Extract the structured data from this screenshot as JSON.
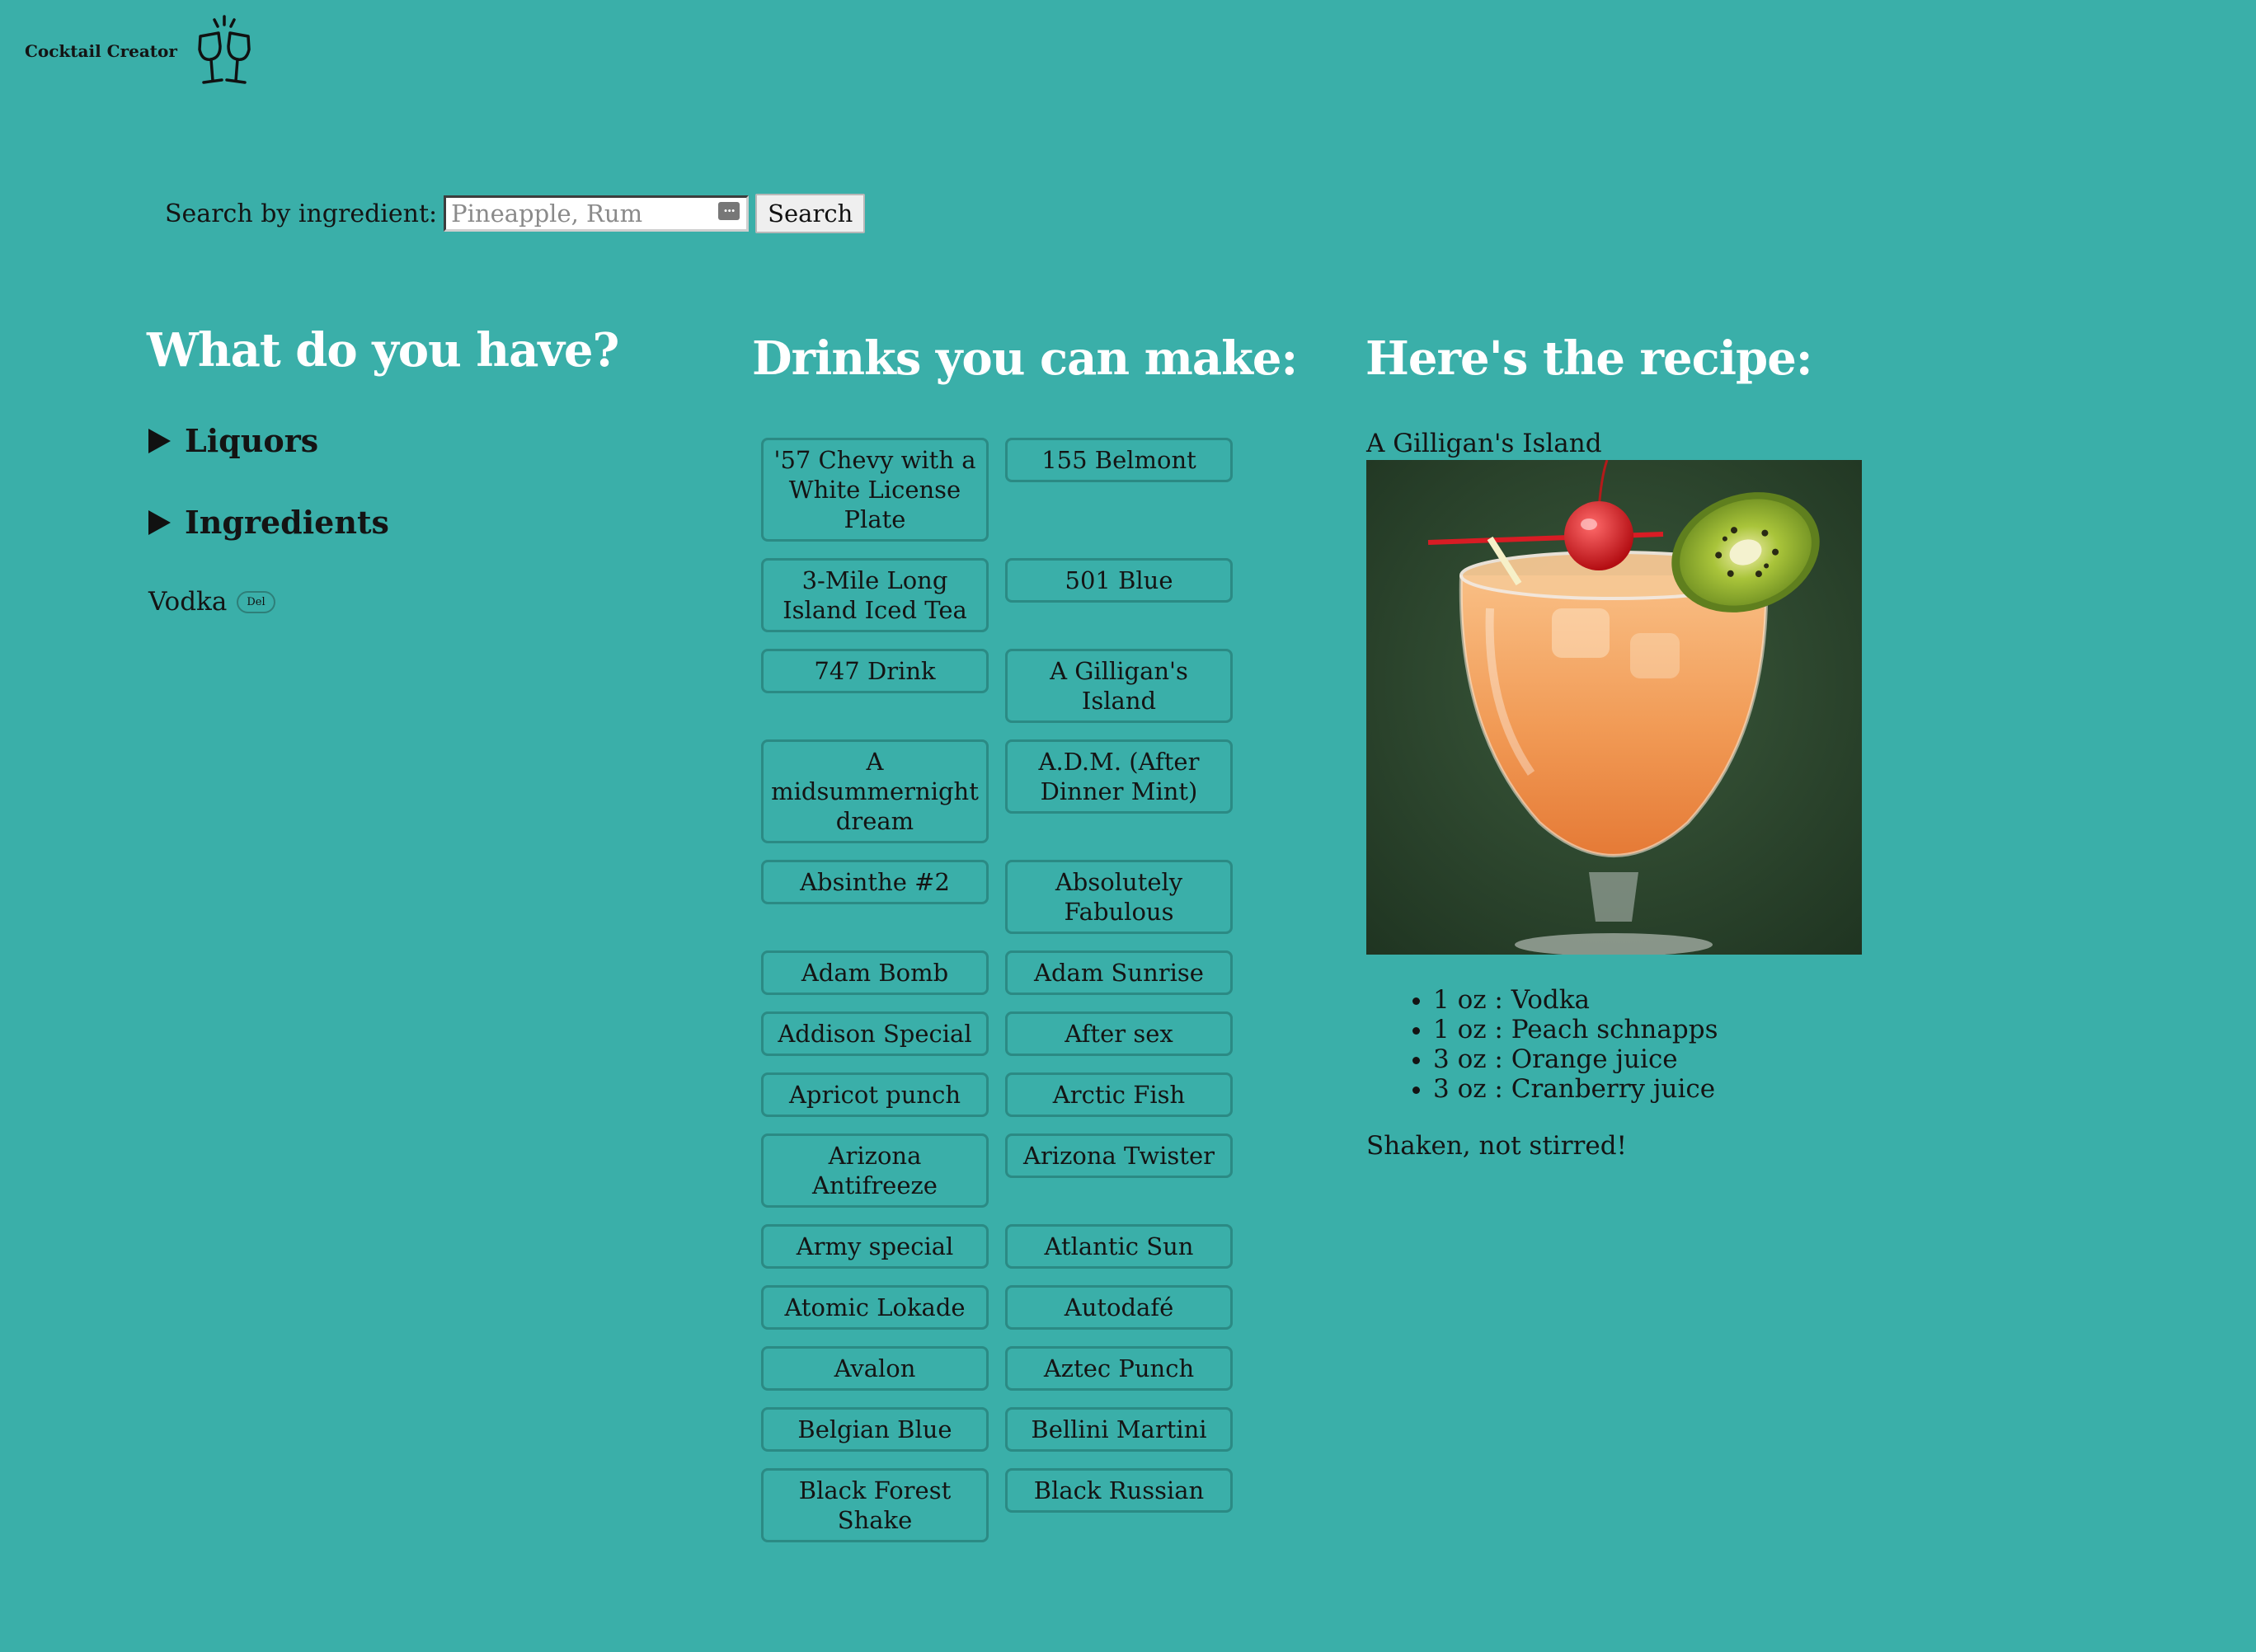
{
  "app": {
    "name": "Cocktail Creator",
    "logo_icon": "clinking-glasses-icon"
  },
  "search": {
    "label": "Search by ingredient:",
    "placeholder": "Pineapple, Rum",
    "value": "",
    "button_label": "Search"
  },
  "have": {
    "heading": "What do you have?",
    "sections": [
      {
        "label": "Liquors",
        "expanded": false
      },
      {
        "label": "Ingredients",
        "expanded": false
      }
    ],
    "selected": [
      {
        "name": "Vodka",
        "delete_label": "Del"
      }
    ]
  },
  "drinks": {
    "heading": "Drinks you can make:",
    "items": [
      "'57 Chevy with a White License Plate",
      "155 Belmont",
      "3-Mile Long Island Iced Tea",
      "501 Blue",
      "747 Drink",
      "A Gilligan's Island",
      "A midsummernight dream",
      "A.D.M. (After Dinner Mint)",
      "Absinthe #2",
      "Absolutely Fabulous",
      "Adam Bomb",
      "Adam Sunrise",
      "Addison Special",
      "After sex",
      "Apricot punch",
      "Arctic Fish",
      "Arizona Antifreeze",
      "Arizona Twister",
      "Army special",
      "Atlantic Sun",
      "Atomic Lokade",
      "Autodafé",
      "Avalon",
      "Aztec Punch",
      "Belgian Blue",
      "Bellini Martini",
      "Black Forest Shake",
      "Black Russian"
    ]
  },
  "recipe": {
    "heading": "Here's the recipe:",
    "name": "A Gilligan's Island",
    "ingredients": [
      "1 oz : Vodka",
      "1 oz : Peach schnapps",
      "3 oz : Orange juice",
      "3 oz : Cranberry juice"
    ],
    "instructions": "Shaken, not stirred!"
  },
  "colors": {
    "background": "#3aafa9",
    "heading": "#ffffff",
    "text": "#141414",
    "button_border": "#2b8a84"
  }
}
